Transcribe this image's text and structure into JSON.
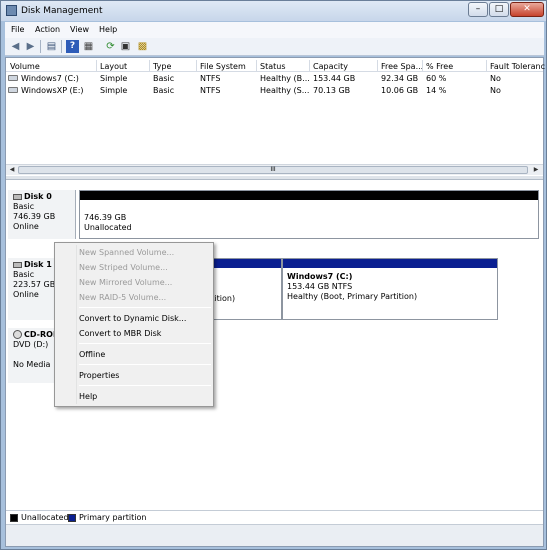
{
  "window": {
    "title": "Disk Management",
    "min": "–",
    "max": "□",
    "close": "✕"
  },
  "menubar": {
    "items": [
      "File",
      "Action",
      "View",
      "Help"
    ]
  },
  "toolbar": {
    "icons": [
      "back-arrow-icon",
      "forward-arrow-icon",
      "console-tree-icon",
      "help-icon",
      "properties-icon",
      "refresh-icon",
      "rescan-icon",
      "settings-icon"
    ]
  },
  "volume_list": {
    "columns": [
      "Volume",
      "Layout",
      "Type",
      "File System",
      "Status",
      "Capacity",
      "Free Spa...",
      "% Free",
      "Fault Toleranc"
    ],
    "rows": [
      [
        "Windows7 (C:)",
        "Simple",
        "Basic",
        "NTFS",
        "Healthy (B...",
        "153.44 GB",
        "92.34 GB",
        "60 %",
        "No"
      ],
      [
        "WindowsXP (E:)",
        "Simple",
        "Basic",
        "NTFS",
        "Healthy (S...",
        "70.13 GB",
        "10.06 GB",
        "14 %",
        "No"
      ]
    ],
    "scroll_mark": "III"
  },
  "disks": [
    {
      "name": "Disk 0",
      "type": "Basic",
      "size": "746.39 GB",
      "status": "Online"
    },
    {
      "name": "Disk 1",
      "type": "Basic",
      "size": "223.57 GB",
      "status": "Online"
    },
    {
      "name": "CD-ROM",
      "type": "DVD (D:)",
      "media": "No Media"
    }
  ],
  "partitions": {
    "disk0_unallocated": {
      "size": "746.39 GB",
      "label": "Unallocated"
    },
    "disk1_hidden_partition_fragment": "rtition)",
    "disk1_windows7": {
      "title": "Windows7  (C:)",
      "size": "153.44 GB NTFS",
      "status": "Healthy (Boot, Primary Partition)"
    }
  },
  "legend": {
    "unallocated": "Unallocated",
    "primary": "Primary partition"
  },
  "colors": {
    "unallocated": "#000000",
    "primary": "#0a1f91"
  },
  "context_menu": {
    "new_spanned": "New Spanned Volume...",
    "new_striped": "New Striped Volume...",
    "new_mirrored": "New Mirrored Volume...",
    "new_raid5": "New RAID-5 Volume...",
    "convert_dynamic": "Convert to Dynamic Disk...",
    "convert_mbr": "Convert to MBR Disk",
    "offline": "Offline",
    "properties": "Properties",
    "help": "Help"
  }
}
